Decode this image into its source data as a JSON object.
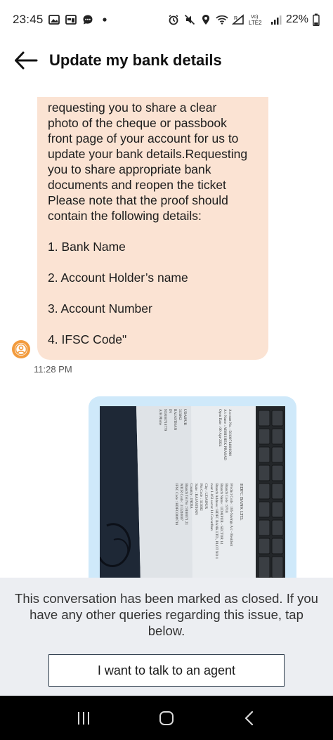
{
  "status_bar": {
    "time": "23:45",
    "battery": "22%",
    "icons_left": [
      "image-icon",
      "calendar-icon",
      "chat-icon",
      "dot-icon"
    ],
    "icons_right": [
      "alarm-icon",
      "mute-icon",
      "location-icon",
      "wifi-icon",
      "signal-icon",
      "volte-icon",
      "signal-icon"
    ],
    "network_label": "LTE2"
  },
  "header": {
    "title": "Update my bank details",
    "back_icon": "arrow-left-icon"
  },
  "chat": {
    "agent_message": {
      "lines": [
        "requesting you to share a clear",
        "photo of the cheque or passbook",
        "front page of your account for us to",
        "update your bank details.Requesting",
        "you to share appropriate bank",
        "documents and reopen the ticket",
        "Please note that the proof should",
        "contain the following details:"
      ],
      "list": [
        "1. Bank Name",
        "2. Account Holder’s name",
        "3. Account Number",
        "4. IFSC Code\""
      ],
      "time": "11:28 PM"
    },
    "user_image": {
      "description_icon": "photo-icon",
      "photo_text": {
        "bank_name": "HDFC BANK LTD.",
        "lines": [
          "Product Code : 185-Savings A/c - Resident",
          "Account No. : 50100714801988",
          "Branch Code : 9718",
          "A/c Name : ABHISHEK PRASAD",
          "Branch Name : UDAIPUR - SECTOR 14",
          "Open Date : 06-Apr-2024",
          "Branch Address : HDFC BANK LTD., PLOT NO 1",
          "near 1-163 sector 14 Goverdhan",
          "City : UDAIPUR",
          "UDAIPUR",
          "Pin Code : 313002",
          "313002",
          "State : RAJASTHAN",
          "RAJASTHAN",
          "Country : INDIA",
          "IN",
          "Branch Tel No : 9180071 21",
          "MICR Code : 313240007",
          "919180718779",
          "IFSC Code : HDFC0009718",
          "A/H Phone"
        ]
      }
    }
  },
  "closed_panel": {
    "text": "This conversation has been marked as closed. If you have any other queries regarding this issue, tap below.",
    "button_label": "I want to talk to an agent"
  },
  "nav_bar": {
    "buttons": [
      "recents-icon",
      "home-icon",
      "back-chevron-icon"
    ]
  },
  "colors": {
    "agent_bubble": "#fbe3d3",
    "user_bubble": "#cfe9fa",
    "panel_bg": "#eceef2",
    "avatar": "#f29b3d"
  }
}
